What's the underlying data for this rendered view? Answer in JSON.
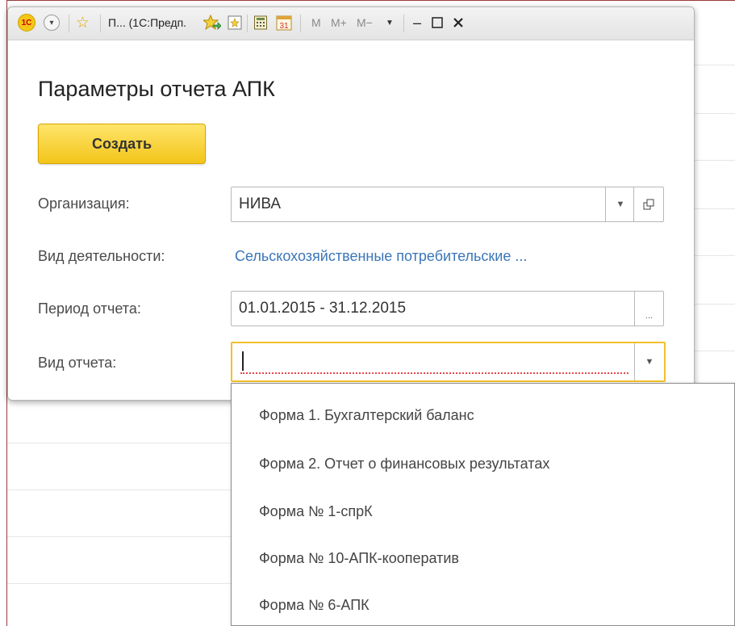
{
  "titlebar": {
    "logo": "1С",
    "title": "П... (1С:Предп.",
    "calendar_day": "31",
    "mem_m": "M",
    "mem_mplus": "M+",
    "mem_mminus": "M−",
    "icons": [
      "logo-1c-icon",
      "dropdown-circle-icon",
      "star-favorite-icon",
      "forward-star-icon",
      "bookmark-icon",
      "calculator-icon",
      "calendar-icon",
      "minimize-icon",
      "maximize-icon",
      "close-icon"
    ]
  },
  "form": {
    "title": "Параметры отчета АПК",
    "create_label": "Создать",
    "organization": {
      "label": "Организация:",
      "value": "НИВА"
    },
    "activity": {
      "label": "Вид деятельности:",
      "value": "Сельскохозяйственные потребительские ..."
    },
    "period": {
      "label": "Период отчета:",
      "value": "01.01.2015 - 31.12.2015",
      "button": "..."
    },
    "report_type": {
      "label": "Вид отчета:",
      "value": ""
    }
  },
  "dropdown": {
    "items": [
      "Форма 1. Бухгалтерский баланс",
      "Форма 2. Отчет о финансовых результатах",
      "Форма № 1-спрК",
      "Форма № 10-АПК-кооператив",
      "Форма № 6-АПК"
    ]
  },
  "colors": {
    "accent_yellow": "#f3c51a",
    "link_blue": "#3b76b8",
    "error_red": "#e34848"
  }
}
